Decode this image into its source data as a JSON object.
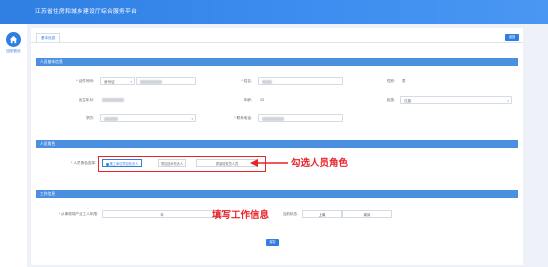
{
  "header": {
    "title": "江苏省住房和城乡建设厅综合服务平台"
  },
  "sidebar": {
    "home_label": "回到首页"
  },
  "tabs": [
    {
      "label": "基本信息"
    }
  ],
  "toolbar": {
    "back_label": "返回"
  },
  "sections": {
    "basic": "人员基本信息",
    "role": "人员角色",
    "work": "工作信息"
  },
  "basic_info": {
    "id_type_label": "* 证件号码:",
    "id_type_value": "身份证",
    "name_label": "* 姓名:",
    "gender_label": "性别:",
    "gender_value": "男",
    "birth_label": "出生年月:",
    "age_label": "年龄:",
    "age_value": "33",
    "ethnicity_label": "民族:",
    "ethnicity_value": "汉族",
    "education_label": "学历:",
    "phone_label": "* 联系电话:"
  },
  "role": {
    "label": "* 人员角色选择:",
    "options": [
      {
        "label": "施工单位项目负责人",
        "checked": true
      },
      {
        "label": "项目技术负责人",
        "checked": false
      },
      {
        "label": "质量检查员人员",
        "checked": false
      }
    ],
    "annotation": "勾选人员角色"
  },
  "work": {
    "label": "* 从事现场产业工人年限:",
    "unit": "年",
    "status_label": "当前状态:",
    "status_options": [
      "上岗",
      "离岗"
    ],
    "annotation": "填写工作信息"
  },
  "form": {
    "submit_label": "保存"
  },
  "colors": {
    "primary": "#2f7fe3",
    "annotation_red": "#e8232a"
  }
}
